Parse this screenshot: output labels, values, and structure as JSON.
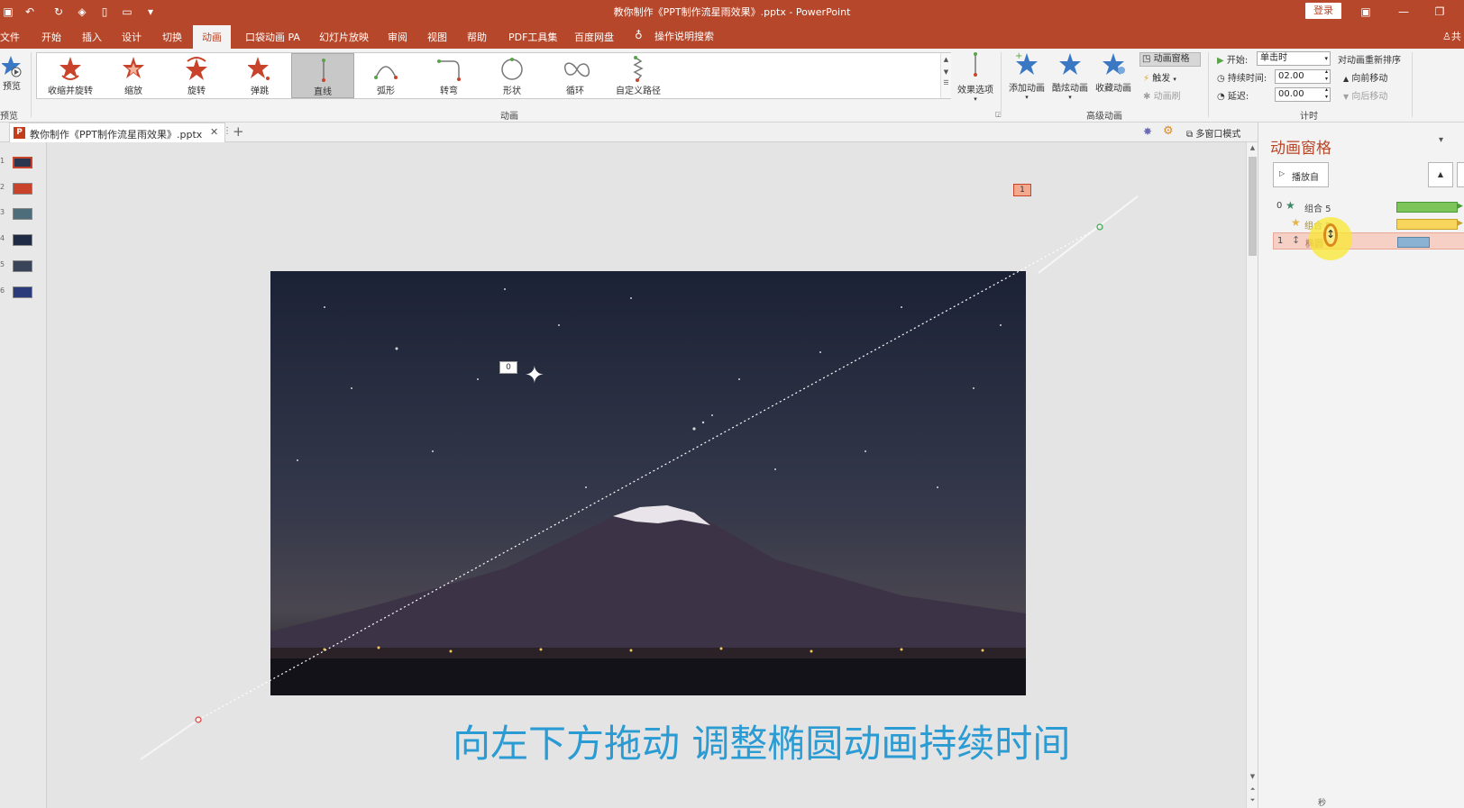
{
  "window": {
    "title": "教你制作《PPT制作流星雨效果》.pptx  -  PowerPoint",
    "login": "登录"
  },
  "menu": {
    "tabs": [
      "文件",
      "开始",
      "插入",
      "设计",
      "切换",
      "动画",
      "口袋动画 PA",
      "幻灯片放映",
      "审阅",
      "视图",
      "帮助",
      "PDF工具集",
      "百度网盘"
    ],
    "active": "动画",
    "search": "操作说明搜索",
    "share": "共"
  },
  "ribbon": {
    "preview_label": "预览",
    "preview_group": "预览",
    "animations": [
      "收缩并旋转",
      "缩放",
      "旋转",
      "弹跳",
      "直线",
      "弧形",
      "转弯",
      "形状",
      "循环",
      "自定义路径"
    ],
    "selected_animation": "直线",
    "effect_options": "效果选项",
    "animation_group": "动画",
    "add_animation": "添加动画",
    "cool_animation": "酷炫动画",
    "fav_animation": "收藏动画",
    "animation_pane_btn": "动画窗格",
    "trigger": "触发",
    "anim_painter": "动画刷",
    "advanced_group": "高级动画",
    "start_label": "开始:",
    "start_value": "单击时",
    "duration_label": "持续时间:",
    "duration_value": "02.00",
    "delay_label": "延迟:",
    "delay_value": "00.00",
    "timing_group": "计时",
    "reorder_title": "对动画重新排序",
    "move_earlier": "向前移动",
    "move_later": "向后移动"
  },
  "tabstrip": {
    "doc_tab": "教你制作《PPT制作流星雨效果》.pptx",
    "multi_window": "多窗口模式"
  },
  "thumbnails": [
    "1",
    "2",
    "3",
    "4",
    "5",
    "6"
  ],
  "slide": {
    "caption": "向左下方拖动 调整椭圆动画持续时间",
    "tag_top": "1",
    "tag_star": "0"
  },
  "anim_pane": {
    "title": "动画窗格",
    "play_from": "播放自",
    "rows": [
      {
        "num": "0",
        "name": "组合 5",
        "color": "#7dc45a"
      },
      {
        "num": "",
        "name": "组合 5",
        "color": "#f7d55a"
      },
      {
        "num": "1",
        "name": "椭圆 6",
        "color": "#8bb2d3"
      }
    ],
    "footer_unit": "秒"
  }
}
